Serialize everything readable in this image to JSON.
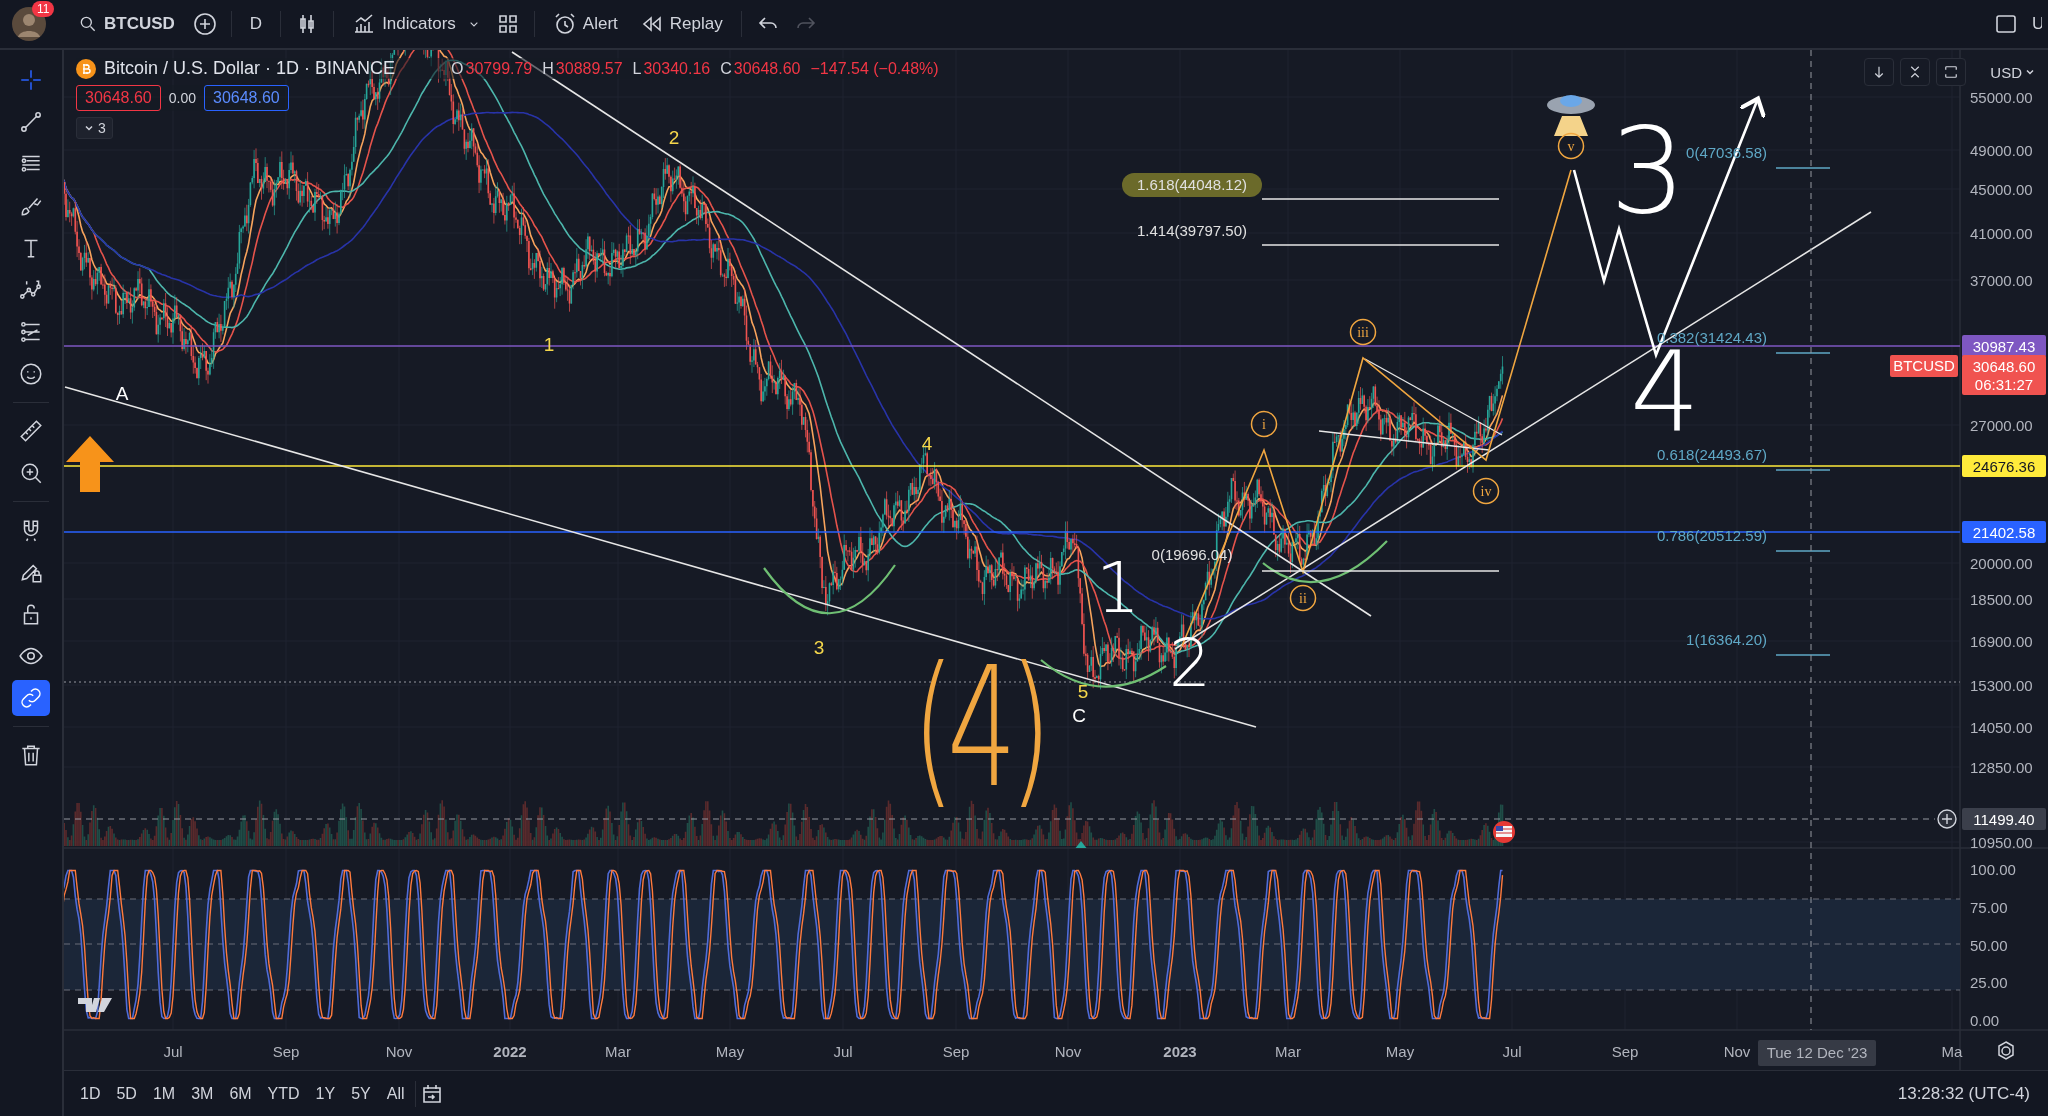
{
  "top_bar": {
    "avatar_badge": "11",
    "symbol": "BTCUSD",
    "interval": "D",
    "indicators": "Indicators",
    "alert": "Alert",
    "replay": "Replay",
    "redo_disabled": true,
    "right_cut": "U"
  },
  "tools": [
    {
      "kind": "crosshair",
      "selected": true,
      "on": false
    },
    {
      "kind": "trend-line",
      "selected": false,
      "on": false
    },
    {
      "kind": "fib-lines",
      "selected": false,
      "on": false
    },
    {
      "kind": "brush",
      "selected": false,
      "on": false
    },
    {
      "kind": "text",
      "selected": false,
      "on": false
    },
    {
      "kind": "wave-pattern",
      "selected": false,
      "on": false
    },
    {
      "kind": "lines",
      "selected": false,
      "on": false
    },
    {
      "kind": "smiley",
      "selected": false,
      "on": false
    },
    {
      "kind": "ruler",
      "selected": false,
      "on": false
    },
    {
      "kind": "zoom",
      "selected": false,
      "on": false
    },
    {
      "kind": "magnet",
      "selected": false,
      "on": false
    },
    {
      "kind": "pencil-lock",
      "selected": false,
      "on": false
    },
    {
      "kind": "lock",
      "selected": false,
      "on": false
    },
    {
      "kind": "eye",
      "selected": false,
      "on": false
    },
    {
      "kind": "link",
      "selected": false,
      "on": true
    },
    {
      "kind": "trash",
      "selected": false,
      "on": false
    }
  ],
  "legend": {
    "title": "Bitcoin / U.S. Dollar · 1D · BINANCE",
    "ohlc": [
      {
        "key": "O",
        "value": "30799.79"
      },
      {
        "key": "H",
        "value": "30889.57"
      },
      {
        "key": "L",
        "value": "30340.16"
      },
      {
        "key": "C",
        "value": "30648.60"
      }
    ],
    "change": "−147.54 (−0.48%)",
    "bid": "30648.60",
    "spread": "0.00",
    "ask": "30648.60",
    "collapsed_count": "3"
  },
  "currency": "USD",
  "price_axis": [
    "55000.00",
    "49000.00",
    "45000.00",
    "41000.00",
    "37000.00",
    "27000.00",
    "20000.00",
    "18500.00",
    "16900.00",
    "15300.00",
    "14050.00",
    "12850.00",
    "10950.00"
  ],
  "oscillator_axis": [
    "100.00",
    "75.00",
    "50.00",
    "25.00",
    "0.00"
  ],
  "price_tags": [
    {
      "kind": "level",
      "text": "30987.43",
      "color": "#7e57c2"
    },
    {
      "kind": "last",
      "symbol": "BTCUSD",
      "text": "30648.60",
      "countdown": "06:31:27",
      "color": "#f05350"
    },
    {
      "kind": "level",
      "text": "24676.36",
      "color": "#ffeb3b"
    },
    {
      "kind": "level",
      "text": "21402.58",
      "color": "#2962ff"
    },
    {
      "kind": "crosshair",
      "text": "11499.40",
      "color": "#3b3f4b"
    }
  ],
  "wave_labels": [
    {
      "text": "A",
      "color": "#ffffff"
    },
    {
      "text": "1",
      "color": "#f5d74b"
    },
    {
      "text": "2",
      "color": "#f5d74b"
    },
    {
      "text": "3",
      "color": "#f5d74b"
    },
    {
      "text": "4",
      "color": "#f5d74b"
    },
    {
      "text": "5",
      "color": "#f5d74b"
    },
    {
      "text": "C",
      "color": "#ffffff"
    }
  ],
  "wave_circles": [
    "i",
    "ii",
    "iii",
    "iv",
    "v"
  ],
  "brush_labels": [
    "(4)",
    "1",
    "2",
    "3",
    "4"
  ],
  "fib_left": [
    {
      "text": "1.618(44048.12)",
      "highlighted": true
    },
    {
      "text": "1.414(39797.50)",
      "highlighted": false
    },
    {
      "text": "0(19696.04)",
      "highlighted": false
    }
  ],
  "fib_right": [
    "0(47036.58)",
    "0.382(31424.43)",
    "0.618(24493.67)",
    "0.786(20512.59)",
    "1(16364.20)"
  ],
  "time_axis": [
    {
      "text": "Jul",
      "kind": "month"
    },
    {
      "text": "Sep",
      "kind": "month"
    },
    {
      "text": "Nov",
      "kind": "month"
    },
    {
      "text": "2022",
      "kind": "year"
    },
    {
      "text": "Mar",
      "kind": "month"
    },
    {
      "text": "May",
      "kind": "month"
    },
    {
      "text": "Jul",
      "kind": "month"
    },
    {
      "text": "Sep",
      "kind": "month"
    },
    {
      "text": "Nov",
      "kind": "month"
    },
    {
      "text": "2023",
      "kind": "year"
    },
    {
      "text": "Mar",
      "kind": "month"
    },
    {
      "text": "May",
      "kind": "month"
    },
    {
      "text": "Jul",
      "kind": "month"
    },
    {
      "text": "Sep",
      "kind": "month"
    },
    {
      "text": "Nov",
      "kind": "month"
    },
    {
      "text": "Ma",
      "kind": "month"
    }
  ],
  "crosshair_time": "Tue 12 Dec '23",
  "ranges": [
    "1D",
    "5D",
    "1M",
    "3M",
    "6M",
    "YTD",
    "1Y",
    "5Y",
    "All"
  ],
  "clock": "13:28:32 (UTC-4)"
}
